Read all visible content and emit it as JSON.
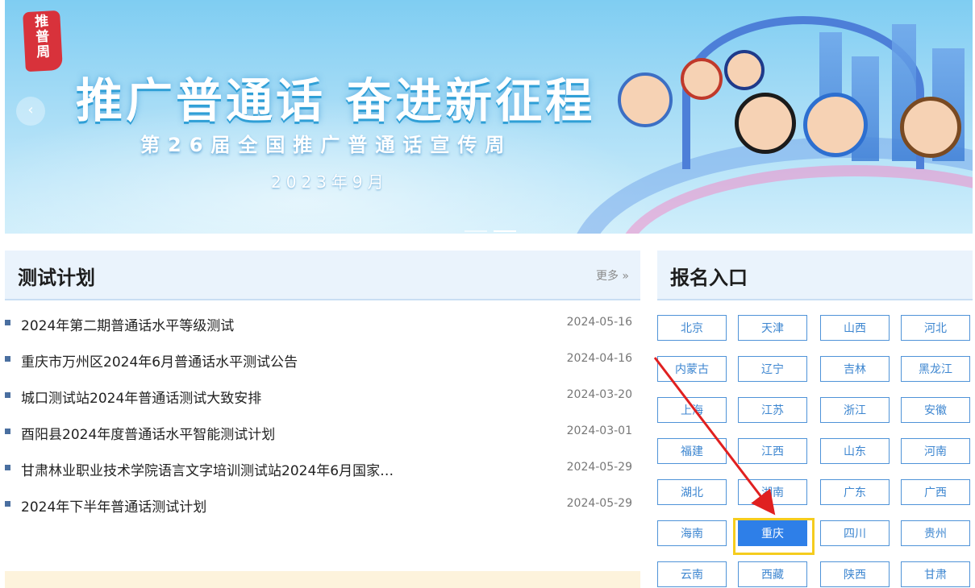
{
  "banner": {
    "seal": [
      "推",
      "普",
      "周"
    ],
    "title": "推广普通话 奋进新征程",
    "subtitle": "第26届全国推广普通话宣传周",
    "date": "2023年9月",
    "prev_label": "‹"
  },
  "test_plan": {
    "title": "测试计划",
    "more": "更多 »",
    "items": [
      {
        "title": "2024年第二期普通话水平等级测试",
        "date": "2024-05-16"
      },
      {
        "title": "重庆市万州区2024年6月普通话水平测试公告",
        "date": "2024-04-16"
      },
      {
        "title": "城口测试站2024年普通话测试大致安排",
        "date": "2024-03-20"
      },
      {
        "title": "酉阳县2024年度普通话水平智能测试计划",
        "date": "2024-03-01"
      },
      {
        "title": "甘肃林业职业技术学院语言文字培训测试站2024年6月国家…",
        "date": "2024-05-29"
      },
      {
        "title": "2024年下半年普通话测试计划",
        "date": "2024-05-29"
      }
    ]
  },
  "registration": {
    "title": "报名入口",
    "selected": "重庆",
    "provinces": [
      "北京",
      "天津",
      "山西",
      "河北",
      "内蒙古",
      "辽宁",
      "吉林",
      "黑龙江",
      "上海",
      "江苏",
      "浙江",
      "安徽",
      "福建",
      "江西",
      "山东",
      "河南",
      "湖北",
      "湖南",
      "广东",
      "广西",
      "海南",
      "重庆",
      "四川",
      "贵州",
      "云南",
      "西藏",
      "陕西",
      "甘肃"
    ]
  },
  "colors": {
    "accent": "#2e7fe8",
    "highlight": "#f5cc1e",
    "arrow": "#e02020"
  }
}
